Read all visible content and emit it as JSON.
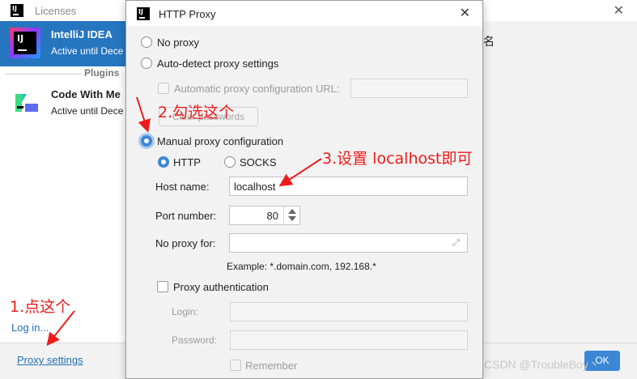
{
  "background": {
    "title": "Licenses",
    "products": [
      {
        "name": "IntelliJ IDEA",
        "status": "Active until Dece"
      },
      {
        "name": "Code With Me",
        "status": "Active until Dece"
      }
    ],
    "plugins_label": "Plugins",
    "login_link": "Log in...",
    "proxy_settings_link": "Proxy settings",
    "right_text": "名",
    "ok_button": "OK"
  },
  "dialog": {
    "title": "HTTP Proxy",
    "no_proxy": "No proxy",
    "auto_detect": "Auto-detect proxy settings",
    "auto_config_url_label": "Automatic proxy configuration URL:",
    "auto_config_url_value": "",
    "clear_passwords": "Clear passwords",
    "manual_config": "Manual proxy configuration",
    "selected_mode": "manual",
    "http_label": "HTTP",
    "socks_label": "SOCKS",
    "protocol": "HTTP",
    "host_label": "Host name:",
    "host_value": "localhost",
    "port_label": "Port number:",
    "port_value": "80",
    "no_proxy_for_label": "No proxy for:",
    "no_proxy_for_value": "",
    "example": "Example: *.domain.com, 192.168.*",
    "proxy_auth_label": "Proxy authentication",
    "login_label": "Login:",
    "login_value": "",
    "password_label": "Password:",
    "password_value": "",
    "remember_label": "Remember"
  },
  "annotations": {
    "step1": "1.点这个",
    "step2": "2.勾选这个",
    "step3": "3.设置 localhost即可",
    "color": "#ee1b1b"
  },
  "watermark": "CSDN @TroubleBoy丶"
}
